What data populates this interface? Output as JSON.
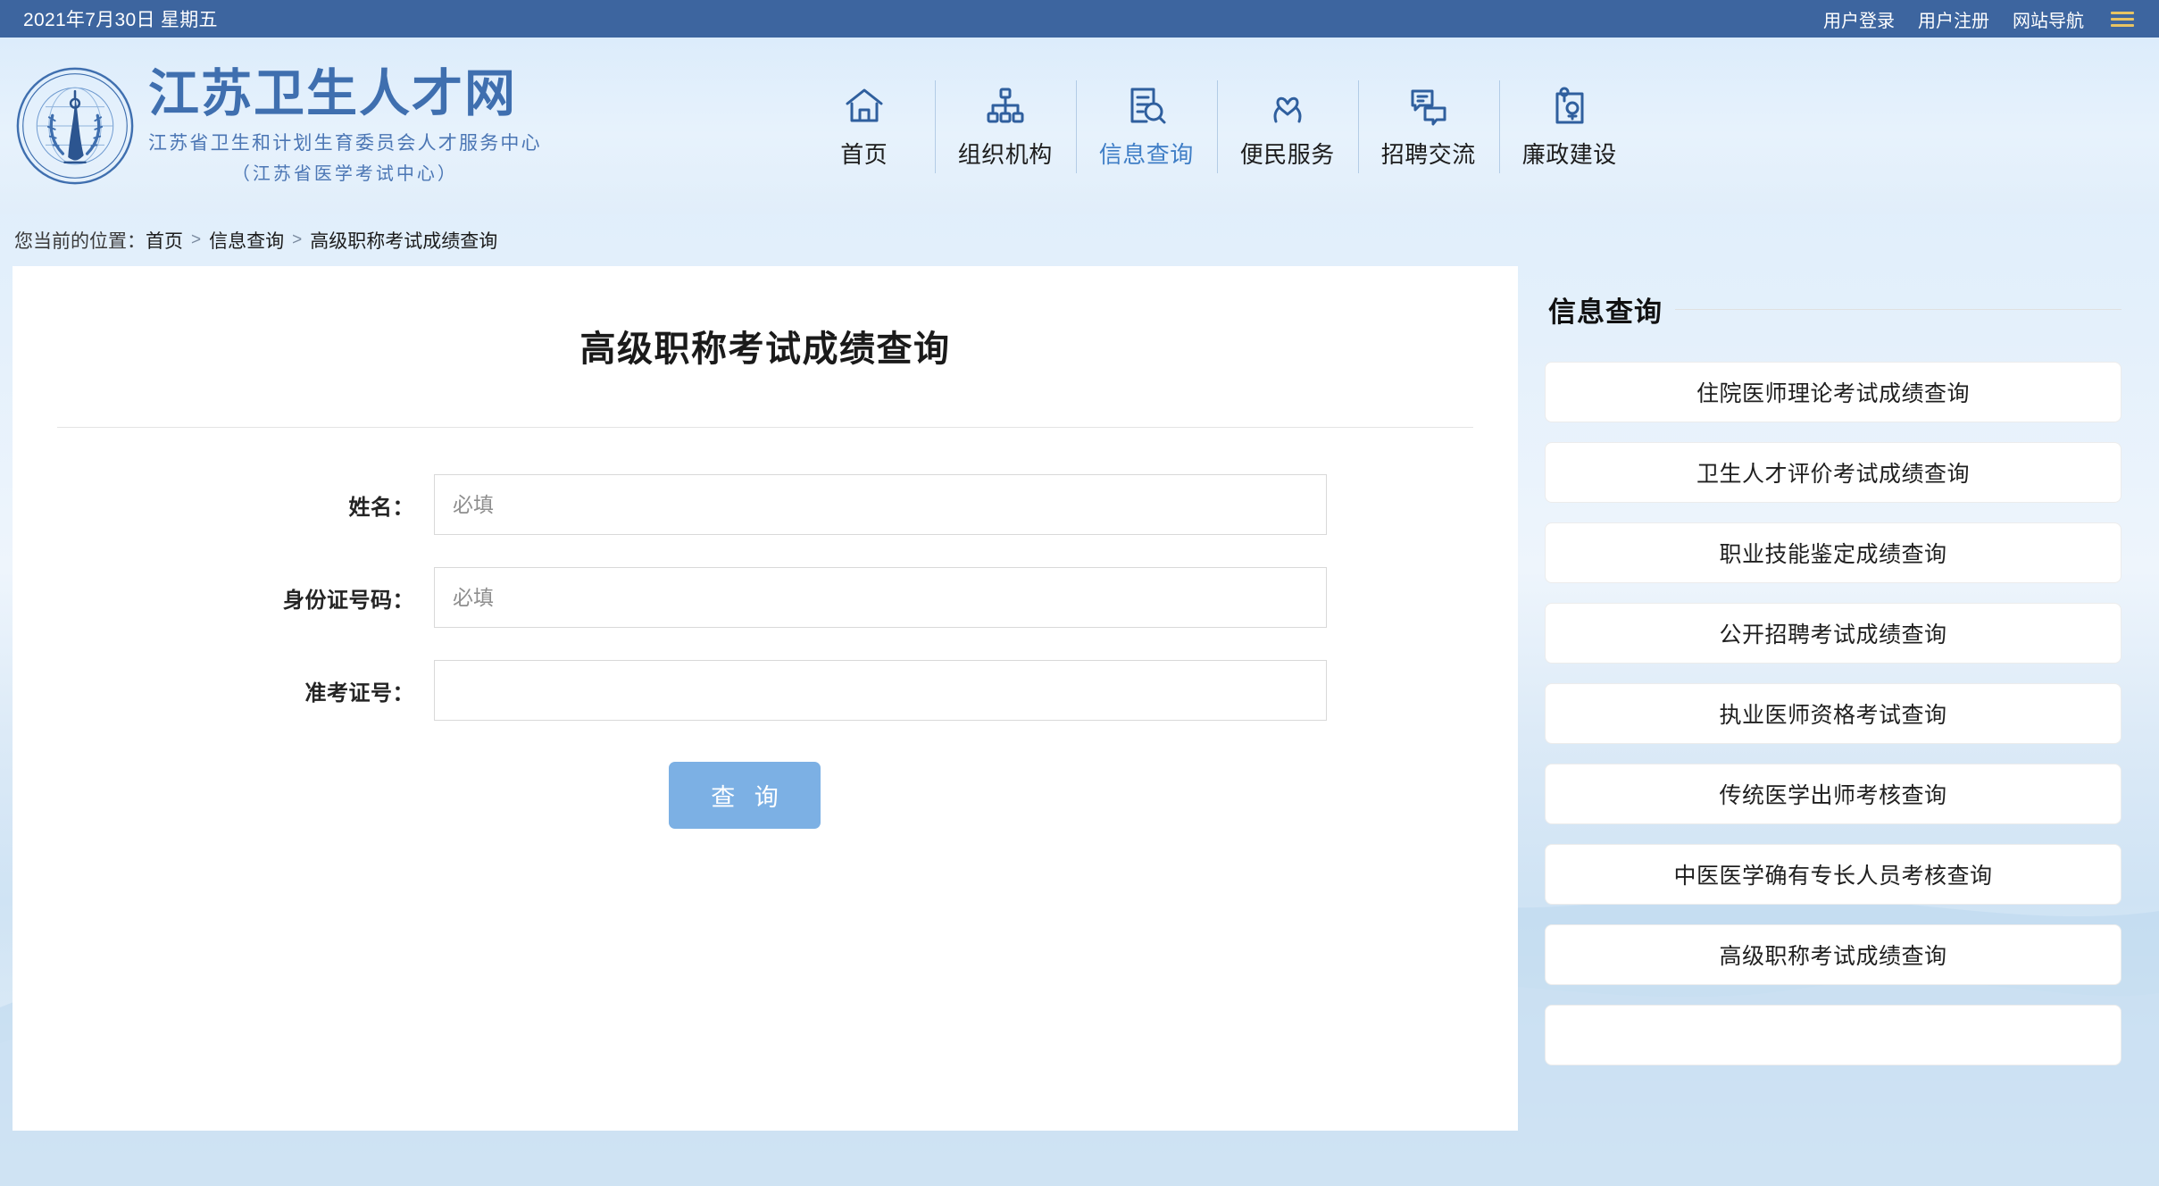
{
  "topbar": {
    "date": "2021年7月30日 星期五",
    "links": [
      {
        "label": "用户登录",
        "name": "user-login"
      },
      {
        "label": "用户注册",
        "name": "user-register"
      },
      {
        "label": "网站导航",
        "name": "site-nav"
      }
    ],
    "menu_icon": "hamburger-icon",
    "background": "#3d659f",
    "menu_icon_color": "#e8c463"
  },
  "header": {
    "emblem_icon": "jiangsu-health-emblem",
    "title": "江苏卫生人才网",
    "sub1": "江苏省卫生和计划生育委员会人才服务中心",
    "sub2": "（江苏省医学考试中心）",
    "brand_color": "#3f6faf"
  },
  "nav": {
    "active_color": "#3f7ec6",
    "items": [
      {
        "label": "首页",
        "icon": "home-icon",
        "active": false
      },
      {
        "label": "组织机构",
        "icon": "org-chart-icon",
        "active": false
      },
      {
        "label": "信息查询",
        "icon": "document-search-icon",
        "active": true
      },
      {
        "label": "便民服务",
        "icon": "heart-hands-icon",
        "active": false
      },
      {
        "label": "招聘交流",
        "icon": "chat-bubbles-icon",
        "active": false
      },
      {
        "label": "廉政建设",
        "icon": "clipboard-seal-icon",
        "active": false
      }
    ]
  },
  "breadcrumb": {
    "label": "您当前的位置：",
    "separator": ">",
    "items": [
      "首页",
      "信息查询",
      "高级职称考试成绩查询"
    ]
  },
  "main": {
    "title": "高级职称考试成绩查询",
    "fields": [
      {
        "label": "姓名：",
        "value": "",
        "placeholder": "必填",
        "name": "name-field"
      },
      {
        "label": "身份证号码：",
        "value": "",
        "placeholder": "必填",
        "name": "id-number-field"
      },
      {
        "label": "准考证号：",
        "value": "",
        "placeholder": "",
        "name": "admission-ticket-field"
      }
    ],
    "submit_label": "查 询",
    "submit_color": "#7cb0e4"
  },
  "sidebar": {
    "heading": "信息查询",
    "items": [
      "住院医师理论考试成绩查询",
      "卫生人才评价考试成绩查询",
      "职业技能鉴定成绩查询",
      "公开招聘考试成绩查询",
      "执业医师资格考试查询",
      "传统医学出师考核查询",
      "中医医学确有专长人员考核查询",
      "高级职称考试成绩查询",
      ""
    ]
  }
}
